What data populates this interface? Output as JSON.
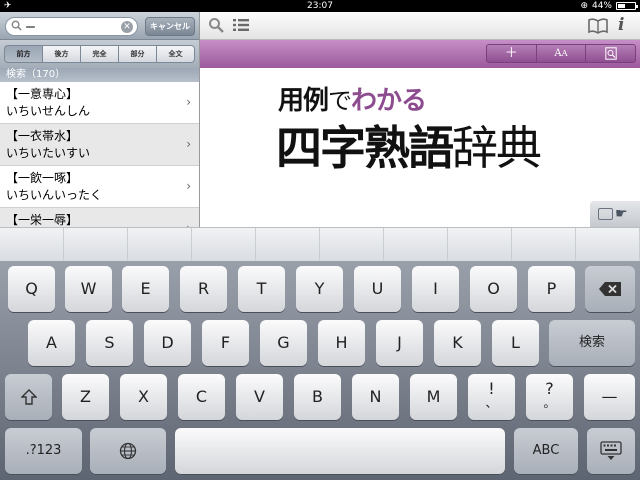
{
  "status_bar": {
    "time": "23:07",
    "battery": "44%",
    "battery_fraction": 0.44
  },
  "search": {
    "value": "ー",
    "cancel_label": "キャンセル"
  },
  "scopes": [
    {
      "label": "前方",
      "selected": true
    },
    {
      "label": "後方",
      "selected": false
    },
    {
      "label": "完全",
      "selected": false
    },
    {
      "label": "部分",
      "selected": false
    },
    {
      "label": "全文",
      "selected": false
    }
  ],
  "results_header": "検索（170）",
  "results": [
    {
      "kanji": "【一意専心】",
      "kana": "いちいせんしん"
    },
    {
      "kanji": "【一衣帯水】",
      "kana": "いちいたいすい"
    },
    {
      "kanji": "【一飲一啄】",
      "kana": "いちいんいったく"
    },
    {
      "kanji": "【一栄一辱】",
      "kana": ""
    }
  ],
  "book_title": {
    "line1_part1": "用例",
    "line1_part2": "で",
    "line1_part3": "わかる",
    "line2_bold": "四字熟語",
    "line2_serif": "辞典"
  },
  "colors": {
    "toolbar": "#9b5a9c",
    "title_accent": "#8c4c8f"
  },
  "keyboard": {
    "row1": [
      "Q",
      "W",
      "E",
      "R",
      "T",
      "Y",
      "U",
      "I",
      "O",
      "P"
    ],
    "row2": [
      "A",
      "S",
      "D",
      "F",
      "G",
      "H",
      "J",
      "K",
      "L"
    ],
    "row3": [
      "Z",
      "X",
      "C",
      "V",
      "B",
      "N",
      "M"
    ],
    "exclaim": "!",
    "exclaim_sub": "、",
    "question": "?",
    "question_sub": "。",
    "dash": "—",
    "search_key": "検索",
    "numbers_key": ".?123",
    "abc_key": "ABC"
  }
}
